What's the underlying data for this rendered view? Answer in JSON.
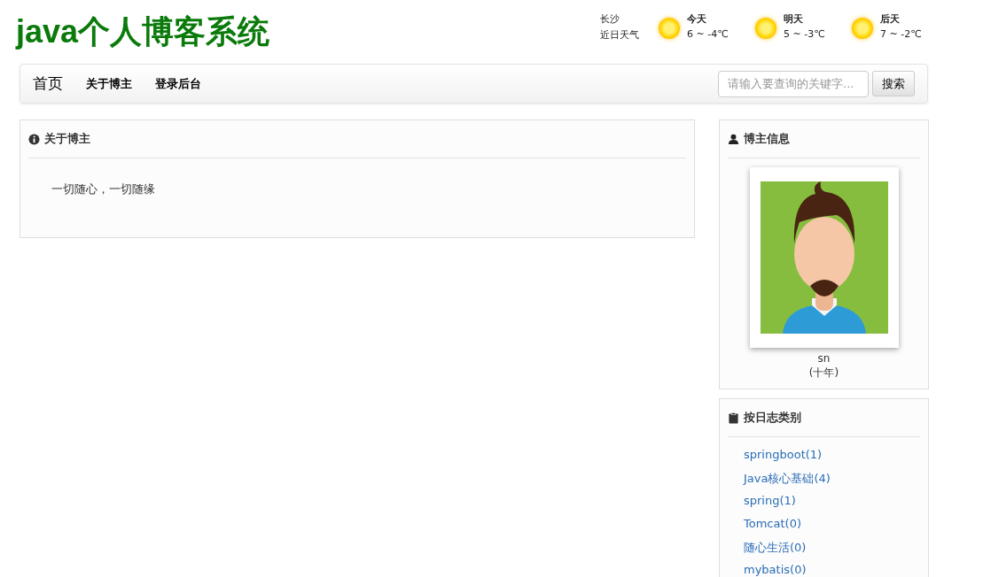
{
  "site_title": "java个人博客系统",
  "weather": {
    "city": "长沙",
    "caption": "近日天气",
    "days": [
      {
        "label": "今天",
        "range": "6 ~ -4℃"
      },
      {
        "label": "明天",
        "range": "5 ~ -3℃"
      },
      {
        "label": "后天",
        "range": "7 ~ -2℃"
      }
    ]
  },
  "nav": {
    "brand": "首页",
    "links": [
      {
        "label": "关于博主"
      },
      {
        "label": "登录后台"
      }
    ],
    "search": {
      "placeholder": "请输入要查询的关键字...",
      "button": "搜索"
    }
  },
  "about": {
    "title": "关于博主",
    "text": "一切随心，一切随缘"
  },
  "blogger": {
    "title": "博主信息",
    "name": "sn",
    "motto": "(十年)"
  },
  "categories": {
    "title": "按日志类别",
    "items": [
      "springboot(1)",
      "Java核心基础(4)",
      "spring(1)",
      "Tomcat(0)",
      "随心生活(0)",
      "mybatis(0)"
    ]
  }
}
